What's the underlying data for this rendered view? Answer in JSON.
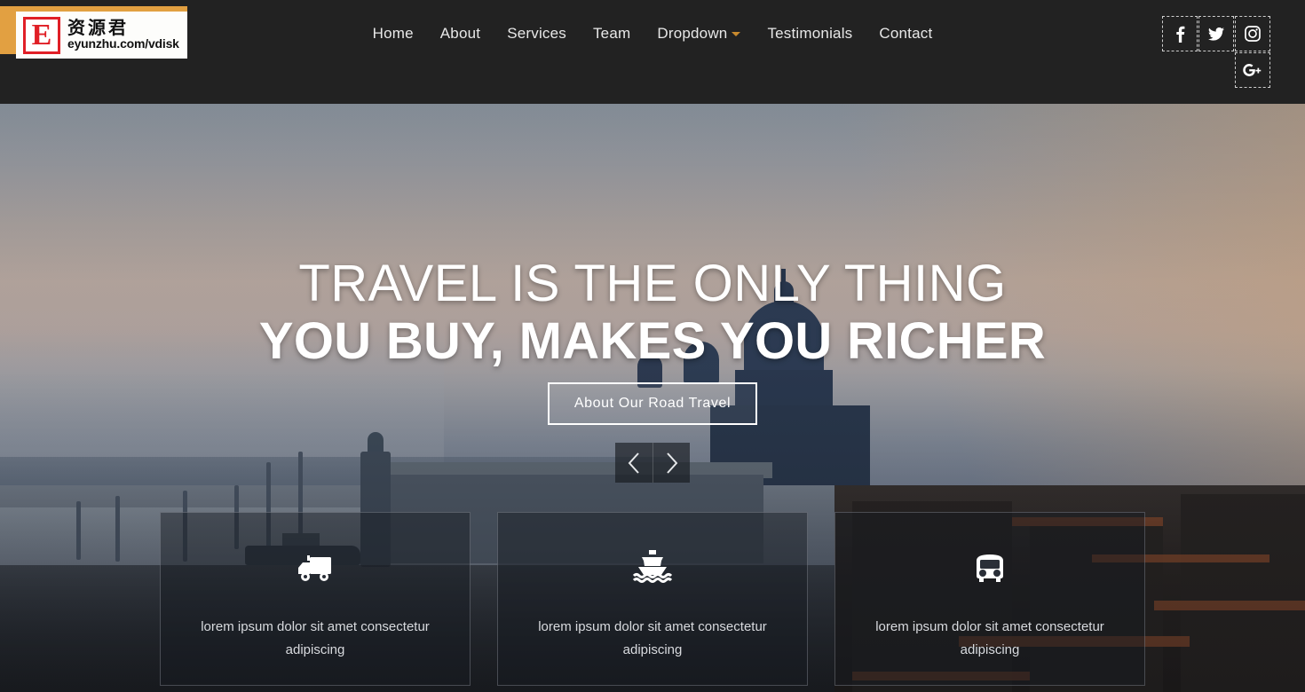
{
  "site": {
    "watermark": {
      "letter": "E",
      "chinese": "资源君",
      "url": "eyunzhu.com/vdisk"
    },
    "header_bg": "#222222",
    "accent": "#c98a2e"
  },
  "nav": {
    "items": [
      {
        "label": "Home",
        "name": "nav-item-home",
        "has_caret": false
      },
      {
        "label": "About",
        "name": "nav-item-about",
        "has_caret": false
      },
      {
        "label": "Services",
        "name": "nav-item-services",
        "has_caret": false
      },
      {
        "label": "Team",
        "name": "nav-item-team",
        "has_caret": false
      },
      {
        "label": "Dropdown",
        "name": "nav-item-dropdown",
        "has_caret": true
      },
      {
        "label": "Testimonials",
        "name": "nav-item-testimonials",
        "has_caret": false
      },
      {
        "label": "Contact",
        "name": "nav-item-contact",
        "has_caret": false
      }
    ]
  },
  "social": {
    "items": [
      {
        "icon": "facebook-icon",
        "label": "Facebook"
      },
      {
        "icon": "twitter-icon",
        "label": "Twitter"
      },
      {
        "icon": "instagram-icon",
        "label": "Instagram"
      },
      {
        "icon": "google-plus-icon",
        "label": "Google Plus"
      }
    ]
  },
  "hero": {
    "heading_line1": "TRAVEL IS THE ONLY THING",
    "heading_line2": "YOU BUY, MAKES YOU RICHER",
    "cta_label": "About Our Road Travel",
    "carousel": {
      "prev_label": "‹",
      "next_label": "›",
      "prev_icon": "chevron-left-icon",
      "next_icon": "chevron-right-icon"
    }
  },
  "features": {
    "cards": [
      {
        "icon": "truck-icon",
        "text": "lorem ipsum dolor sit amet consectetur adipiscing"
      },
      {
        "icon": "ship-icon",
        "text": "lorem ipsum dolor sit amet consectetur adipiscing"
      },
      {
        "icon": "bus-icon",
        "text": "lorem ipsum dolor sit amet consectetur adipiscing"
      }
    ]
  }
}
